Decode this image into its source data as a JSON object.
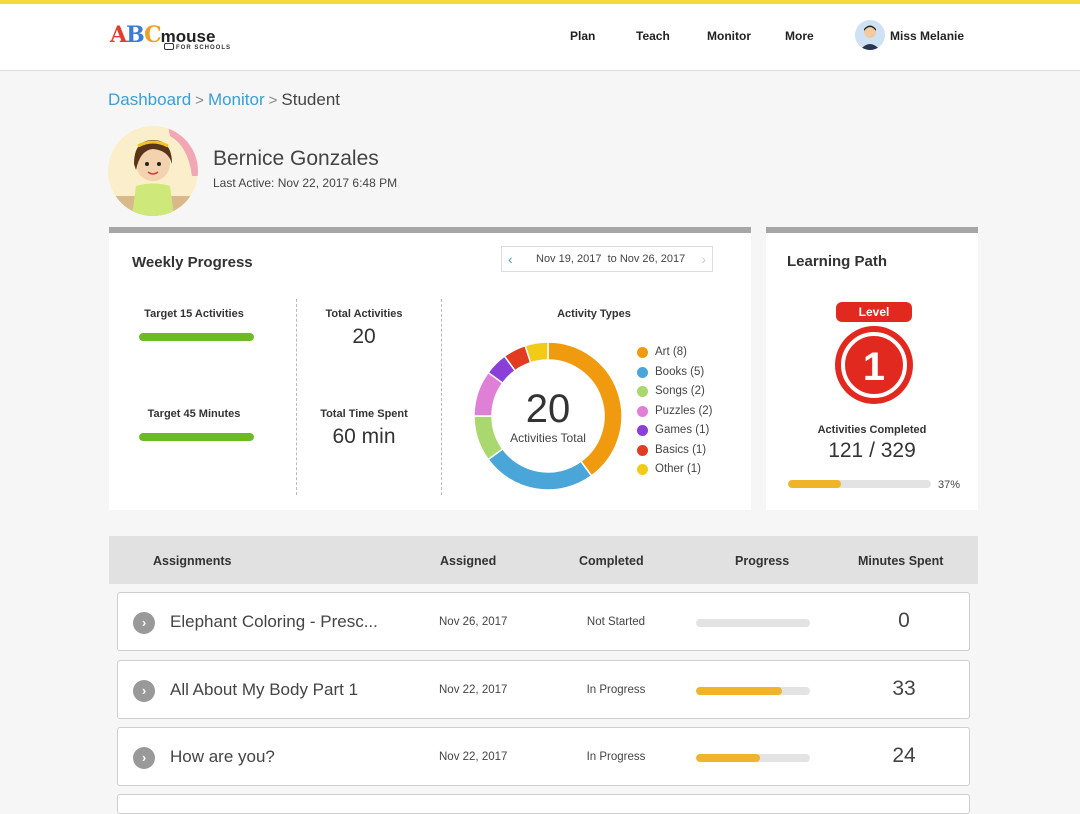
{
  "header": {
    "logo_main": "ABCmouse",
    "logo_sub": "FOR SCHOOLS",
    "nav": [
      "Plan",
      "Teach",
      "Monitor",
      "More"
    ],
    "user_name": "Miss Melanie"
  },
  "breadcrumb": {
    "items": [
      "Dashboard",
      "Monitor"
    ],
    "current": "Student",
    "separator": ">"
  },
  "student": {
    "name": "Bernice Gonzales",
    "last_active": "Last Active: Nov 22, 2017  6:48 PM"
  },
  "weekly": {
    "title": "Weekly Progress",
    "date_from": "Nov 19, 2017",
    "date_to_label": "to",
    "date_to": "Nov 26, 2017",
    "target_activities_label": "Target 15 Activities",
    "target_activities_progress": 1.0,
    "target_minutes_label": "Target 45 Minutes",
    "target_minutes_progress": 1.0,
    "total_activities_label": "Total Activities",
    "total_activities_value": "20",
    "total_time_label": "Total Time Spent",
    "total_time_value": "60 min",
    "bar_color": "#6dbb22"
  },
  "chart_data": {
    "type": "pie",
    "title": "Activity Types",
    "center_value": "20",
    "center_label": "Activities Total",
    "categories": [
      "Art",
      "Books",
      "Songs",
      "Puzzles",
      "Games",
      "Basics",
      "Other"
    ],
    "values": [
      8,
      5,
      2,
      2,
      1,
      1,
      1
    ],
    "legend_labels": [
      "Art (8)",
      "Books (5)",
      "Songs (2)",
      "Puzzles (2)",
      "Games (1)",
      "Basics (1)",
      "Other (1)"
    ],
    "colors": [
      "#f09a0f",
      "#4aa6d9",
      "#a8d86e",
      "#e07fd6",
      "#8a3fd9",
      "#e13b22",
      "#f2cb19"
    ],
    "legend_placement": "right"
  },
  "learning_path": {
    "title": "Learning Path",
    "level_label": "Level",
    "level_value": "1",
    "activities_completed_label": "Activities Completed",
    "activities_completed_value": "121 / 329",
    "progress": 0.37,
    "percent_label": "37%",
    "bar_color": "#f0b429"
  },
  "assignments": {
    "columns": [
      "Assignments",
      "Assigned",
      "Completed",
      "Progress",
      "Minutes Spent"
    ],
    "rows": [
      {
        "name": "Elephant Coloring - Presc...",
        "assigned": "Nov 26, 2017",
        "completed": "Not Started",
        "progress": 0,
        "minutes": "0"
      },
      {
        "name": "All About My Body Part 1",
        "assigned": "Nov 22, 2017",
        "completed": "In Progress",
        "progress": 0.75,
        "minutes": "33"
      },
      {
        "name": "How are you?",
        "assigned": "Nov 22, 2017",
        "completed": "In Progress",
        "progress": 0.56,
        "minutes": "24"
      }
    ]
  },
  "icons": {
    "row_expand": "chevron-right-icon",
    "date_prev": "chevron-left-icon",
    "date_next": "chevron-right-icon"
  }
}
